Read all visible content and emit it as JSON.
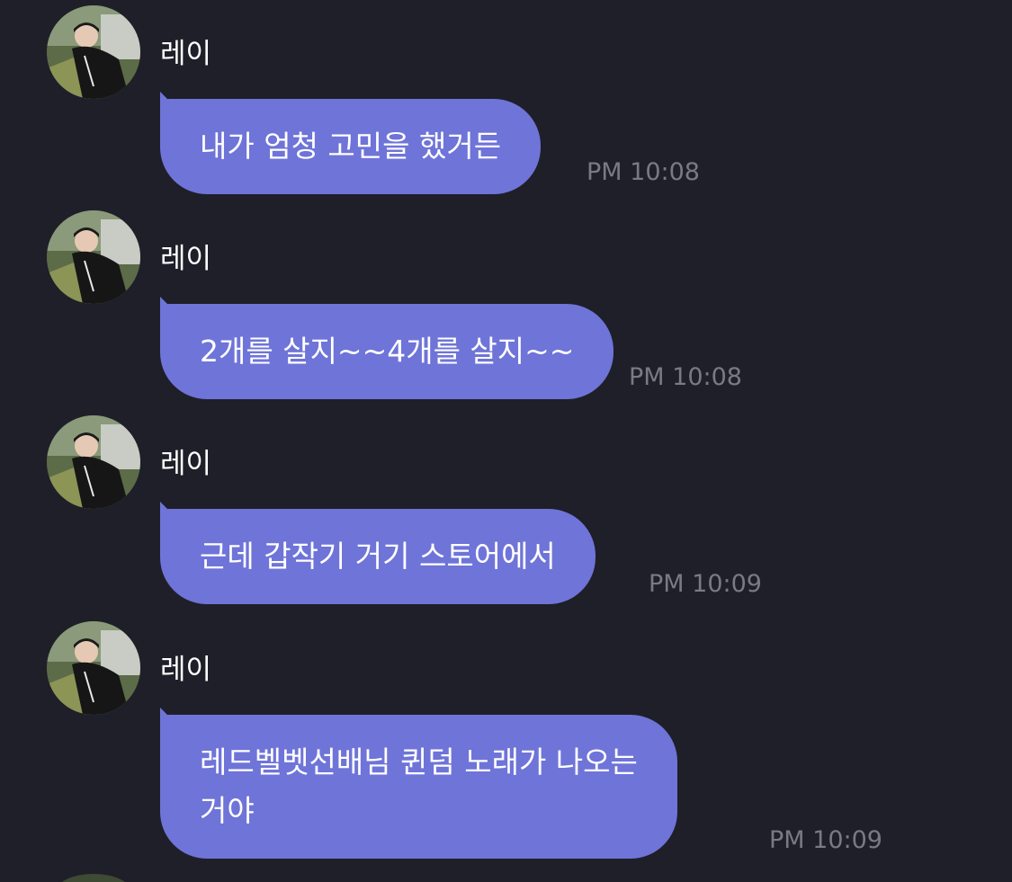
{
  "messages": [
    {
      "sender": "레이",
      "text": "내가 엄청 고민을 했거든",
      "time": "PM 10:08"
    },
    {
      "sender": "레이",
      "text": "2개를 살지~~4개를 살지~~",
      "time": "PM 10:08"
    },
    {
      "sender": "레이",
      "text": "근데 갑작기 거기 스토어에서",
      "time": "PM 10:09"
    },
    {
      "sender": "레이",
      "text_lines": [
        "레드벨벳선배님 퀸덤 노래가 나오는",
        "거야"
      ],
      "time": "PM 10:09"
    }
  ],
  "colors": {
    "background": "#1f1f29",
    "bubble": "#6f74d8",
    "sender_text": "#ffffff",
    "timestamp": "#7a7a86"
  },
  "icons": {
    "avatar": "profile-photo"
  }
}
